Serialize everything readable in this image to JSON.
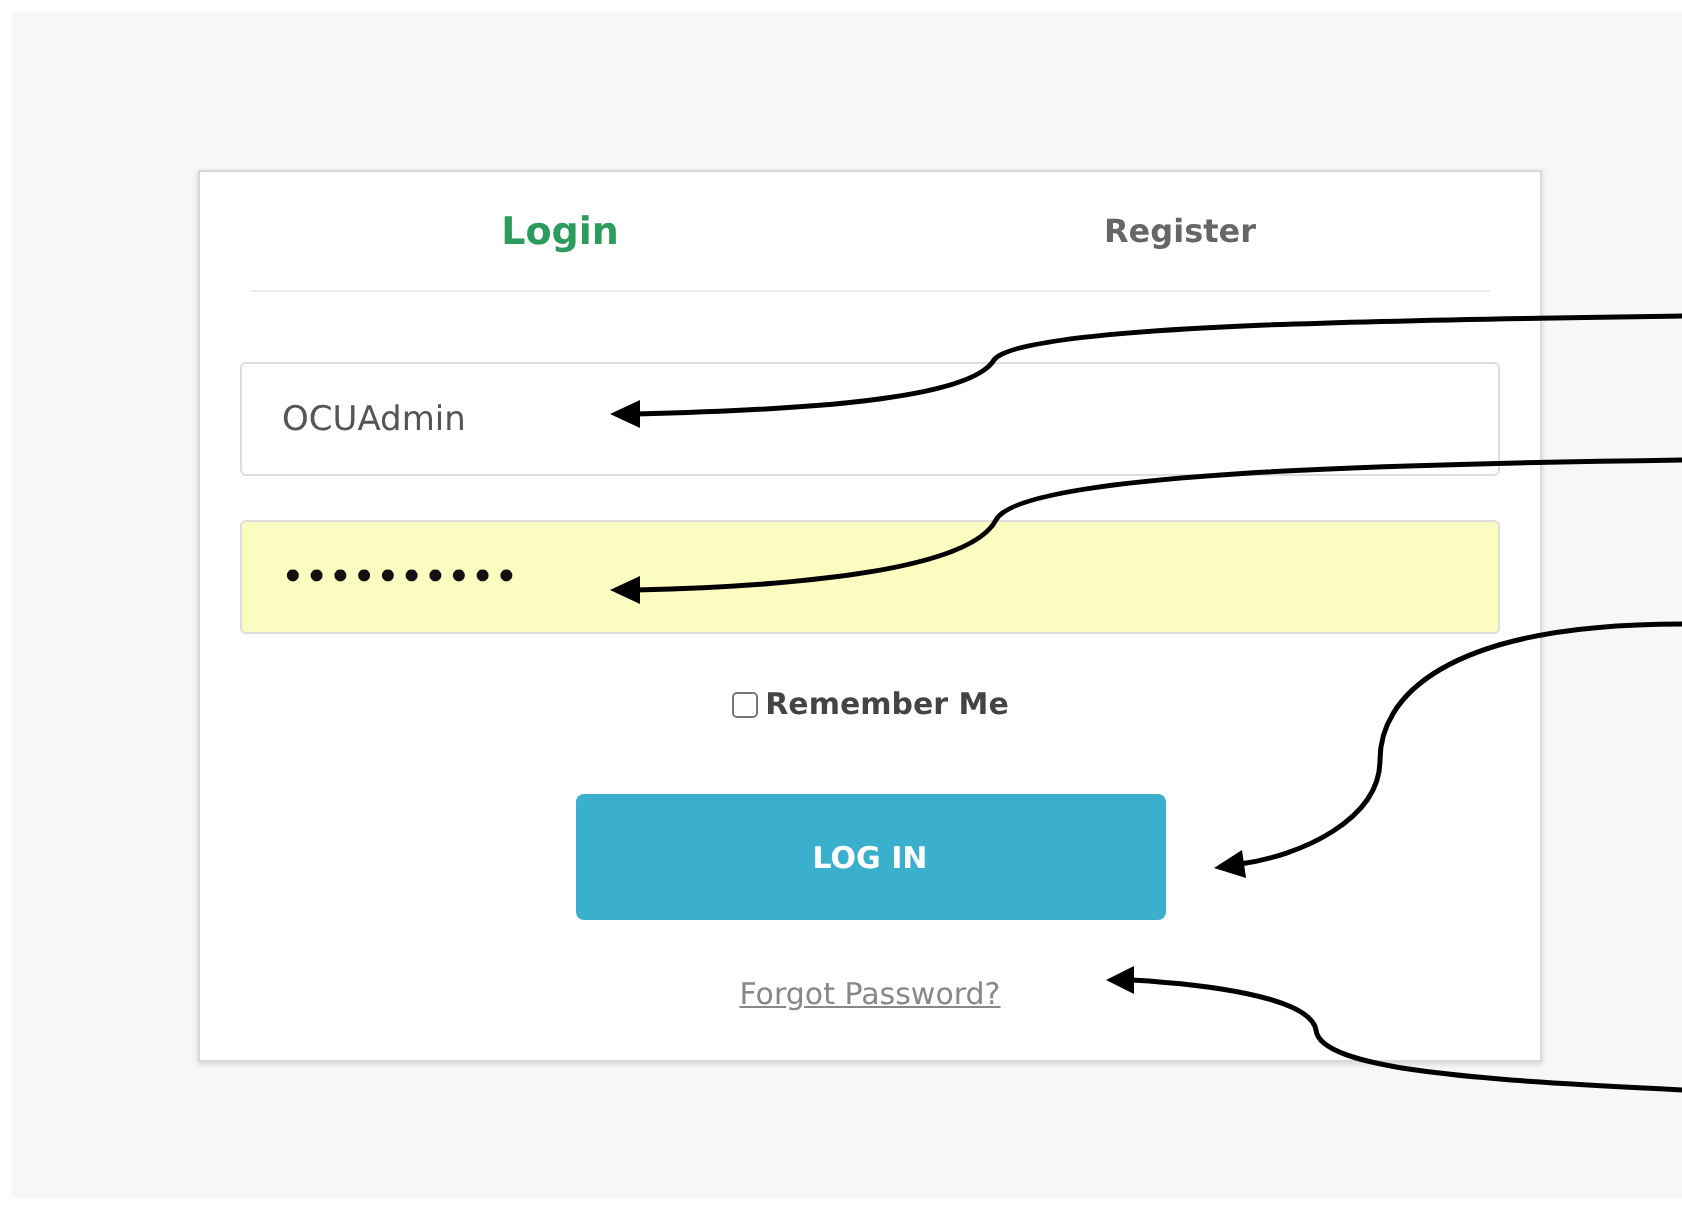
{
  "tabs": [
    {
      "label": "Login",
      "selected": true
    },
    {
      "label": "Register",
      "selected": false
    }
  ],
  "username": {
    "value": "OCUAdmin",
    "highlighted": false
  },
  "password": {
    "value": "••••••••••",
    "highlighted": true
  },
  "remember": {
    "label": "Remember Me",
    "checked": false
  },
  "login_button": {
    "label": "LOG IN"
  },
  "forgot_link": {
    "label": "Forgot Password?"
  }
}
